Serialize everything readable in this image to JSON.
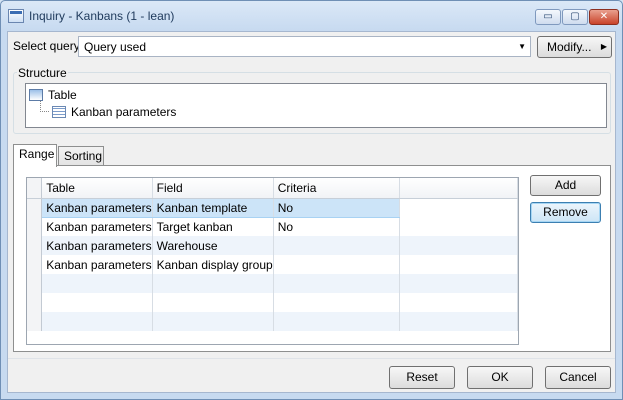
{
  "window": {
    "title": "Inquiry - Kanbans (1 - lean)",
    "controls": {
      "minimize": "▭",
      "maximize": "▢",
      "close": "✕"
    }
  },
  "query": {
    "label": "Select query:",
    "value": "Query used",
    "modify_label": "Modify..."
  },
  "structure": {
    "title": "Structure",
    "nodes": [
      {
        "label": "Table",
        "icon": "table-icon"
      },
      {
        "label": "Kanban parameters",
        "icon": "grid-icon"
      }
    ]
  },
  "tabs": [
    {
      "label": "Range",
      "active": true
    },
    {
      "label": "Sorting",
      "active": false
    }
  ],
  "grid": {
    "columns": [
      "Table",
      "Field",
      "Criteria",
      ""
    ],
    "rows": [
      [
        "Kanban parameters",
        "Kanban template",
        "No",
        ""
      ],
      [
        "Kanban parameters",
        "Target kanban",
        "No",
        ""
      ],
      [
        "Kanban parameters",
        "Warehouse",
        "",
        ""
      ],
      [
        "Kanban parameters",
        "Kanban display group",
        "",
        ""
      ],
      [
        "",
        "",
        "",
        ""
      ],
      [
        "",
        "",
        "",
        ""
      ],
      [
        "",
        "",
        "",
        ""
      ]
    ],
    "current_row": 0
  },
  "side_buttons": {
    "add": "Add",
    "remove": "Remove"
  },
  "footer": {
    "reset": "Reset",
    "ok": "OK",
    "cancel": "Cancel"
  },
  "colors": {
    "accent": "#3c7fb1",
    "selection": "#cce4f8",
    "titlebar": "#c7daf0"
  }
}
